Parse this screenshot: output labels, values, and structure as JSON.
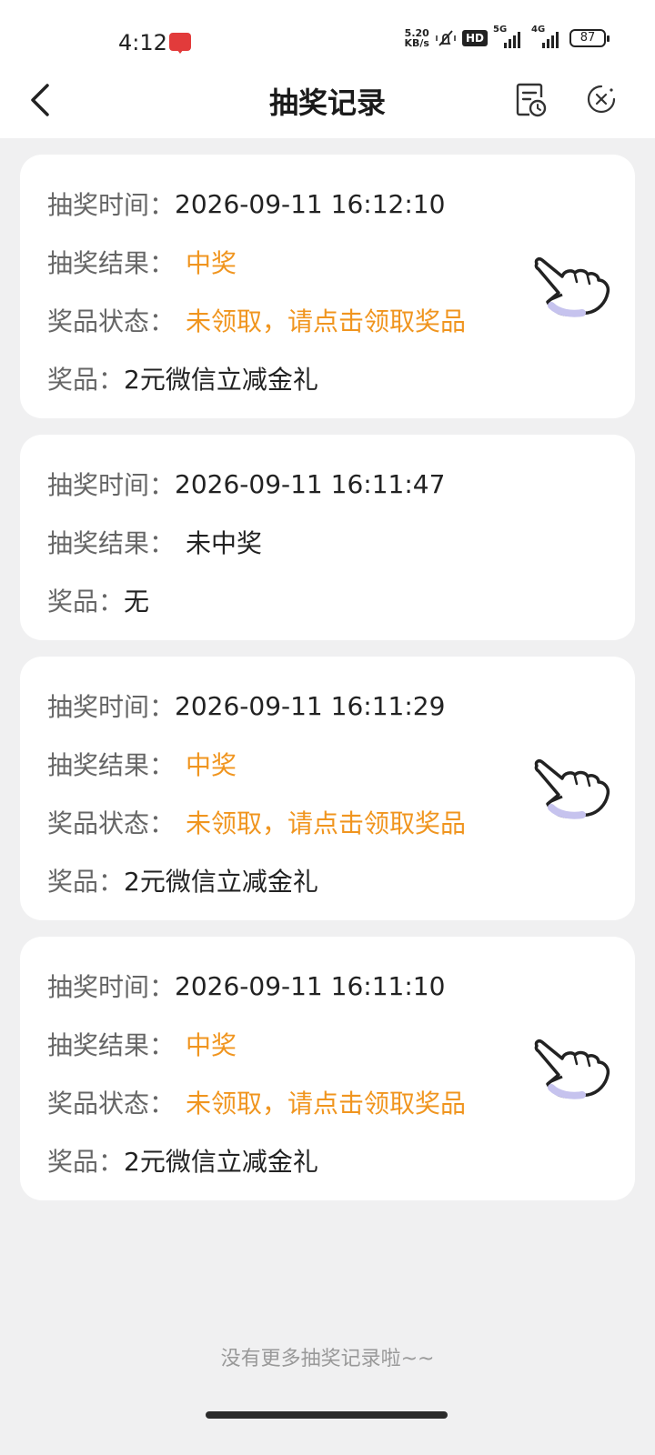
{
  "statusbar": {
    "time": "4:12",
    "netspeed_value": "5.20",
    "netspeed_unit": "KB/s",
    "hd": "HD",
    "sig1": "5G",
    "sig2": "4G",
    "battery": "87"
  },
  "nav": {
    "title": "抽奖记录"
  },
  "records": [
    {
      "time_label": "抽奖时间：",
      "time": "2026-09-11 16:12:10",
      "result_label": "抽奖结果：",
      "result": "中奖",
      "status_label": "奖品状态：",
      "status": "未领取，请点击领取奖品",
      "prize_label": "奖品：",
      "prize": "2元微信立减金礼"
    },
    {
      "time_label": "抽奖时间：",
      "time": "2026-09-11 16:11:47",
      "result_label": "抽奖结果：",
      "result": "未中奖",
      "prize_label": "奖品：",
      "prize": "无"
    },
    {
      "time_label": "抽奖时间：",
      "time": "2026-09-11 16:11:29",
      "result_label": "抽奖结果：",
      "result": "中奖",
      "status_label": "奖品状态：",
      "status": "未领取，请点击领取奖品",
      "prize_label": "奖品：",
      "prize": "2元微信立减金礼"
    },
    {
      "time_label": "抽奖时间：",
      "time": "2026-09-11 16:11:10",
      "result_label": "抽奖结果：",
      "result": "中奖",
      "status_label": "奖品状态：",
      "status": "未领取，请点击领取奖品",
      "prize_label": "奖品：",
      "prize": "2元微信立减金礼"
    }
  ],
  "footer": {
    "note": "没有更多抽奖记录啦~~"
  },
  "colors": {
    "accent_orange": "#f0951f",
    "background": "#f0f0f1",
    "card": "#ffffff"
  },
  "icons": {
    "back": "chevron-left-icon",
    "history": "record-history-icon",
    "close": "close-circle-icon",
    "claim": "pointing-hand-icon"
  }
}
